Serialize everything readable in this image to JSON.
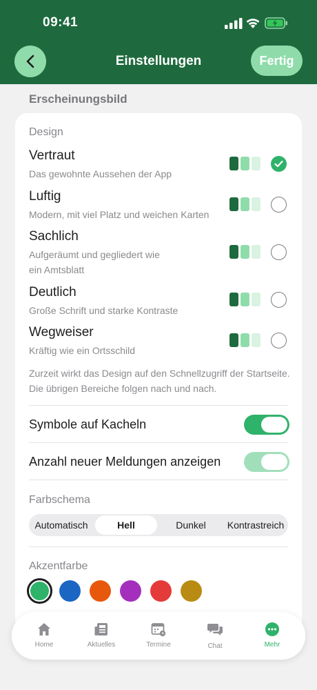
{
  "status": {
    "time": "09:41"
  },
  "header": {
    "title": "Einstellungen",
    "done_label": "Fertig"
  },
  "section_heading": "Erscheinungsbild",
  "design": {
    "label": "Design",
    "options": [
      {
        "title": "Vertraut",
        "desc": "Das gewohnte Aussehen der App",
        "selected": true
      },
      {
        "title": "Luftig",
        "desc": "Modern, mit viel Platz und weichen Karten",
        "selected": false
      },
      {
        "title": "Sachlich",
        "desc_line1": "Aufgeräumt und gegliedert wie",
        "desc_line2": "ein Amtsblatt",
        "selected": false
      },
      {
        "title": "Deutlich",
        "desc": "Große Schrift und starke Kontraste",
        "selected": false
      },
      {
        "title": "Wegweiser",
        "desc": "Kräftig wie ein Ortsschild",
        "selected": false
      }
    ],
    "note": "Zurzeit wirkt das Design auf den Schnellzugriff der Startseite. Die übrigen Bereiche folgen nach und nach."
  },
  "toggles": [
    {
      "label": "Symbole auf Kacheln",
      "on": true
    },
    {
      "label": "Anzahl neuer Meldungen anzeigen",
      "on": true
    }
  ],
  "color_scheme": {
    "label": "Farbschema",
    "options": [
      "Automatisch",
      "Hell",
      "Dunkel",
      "Kontrastreich"
    ],
    "selected": "Hell"
  },
  "accent": {
    "label": "Akzentfarbe",
    "colors": [
      "#2fb26a",
      "#1a66c2",
      "#e8580c",
      "#a42fbd",
      "#e53a3a",
      "#b98b12"
    ],
    "selected_index": 0
  },
  "theme_colors": {
    "header": "#1e6a3e",
    "accent": "#2fb26a",
    "light_accent": "#8fdcaa"
  },
  "tabbar": {
    "items": [
      {
        "label": "Home",
        "icon": "home-icon"
      },
      {
        "label": "Aktuelles",
        "icon": "news-icon"
      },
      {
        "label": "Termine",
        "icon": "calendar-icon"
      },
      {
        "label": "Chat",
        "icon": "chat-icon"
      },
      {
        "label": "Mehr",
        "icon": "more-icon",
        "active": true
      }
    ]
  }
}
